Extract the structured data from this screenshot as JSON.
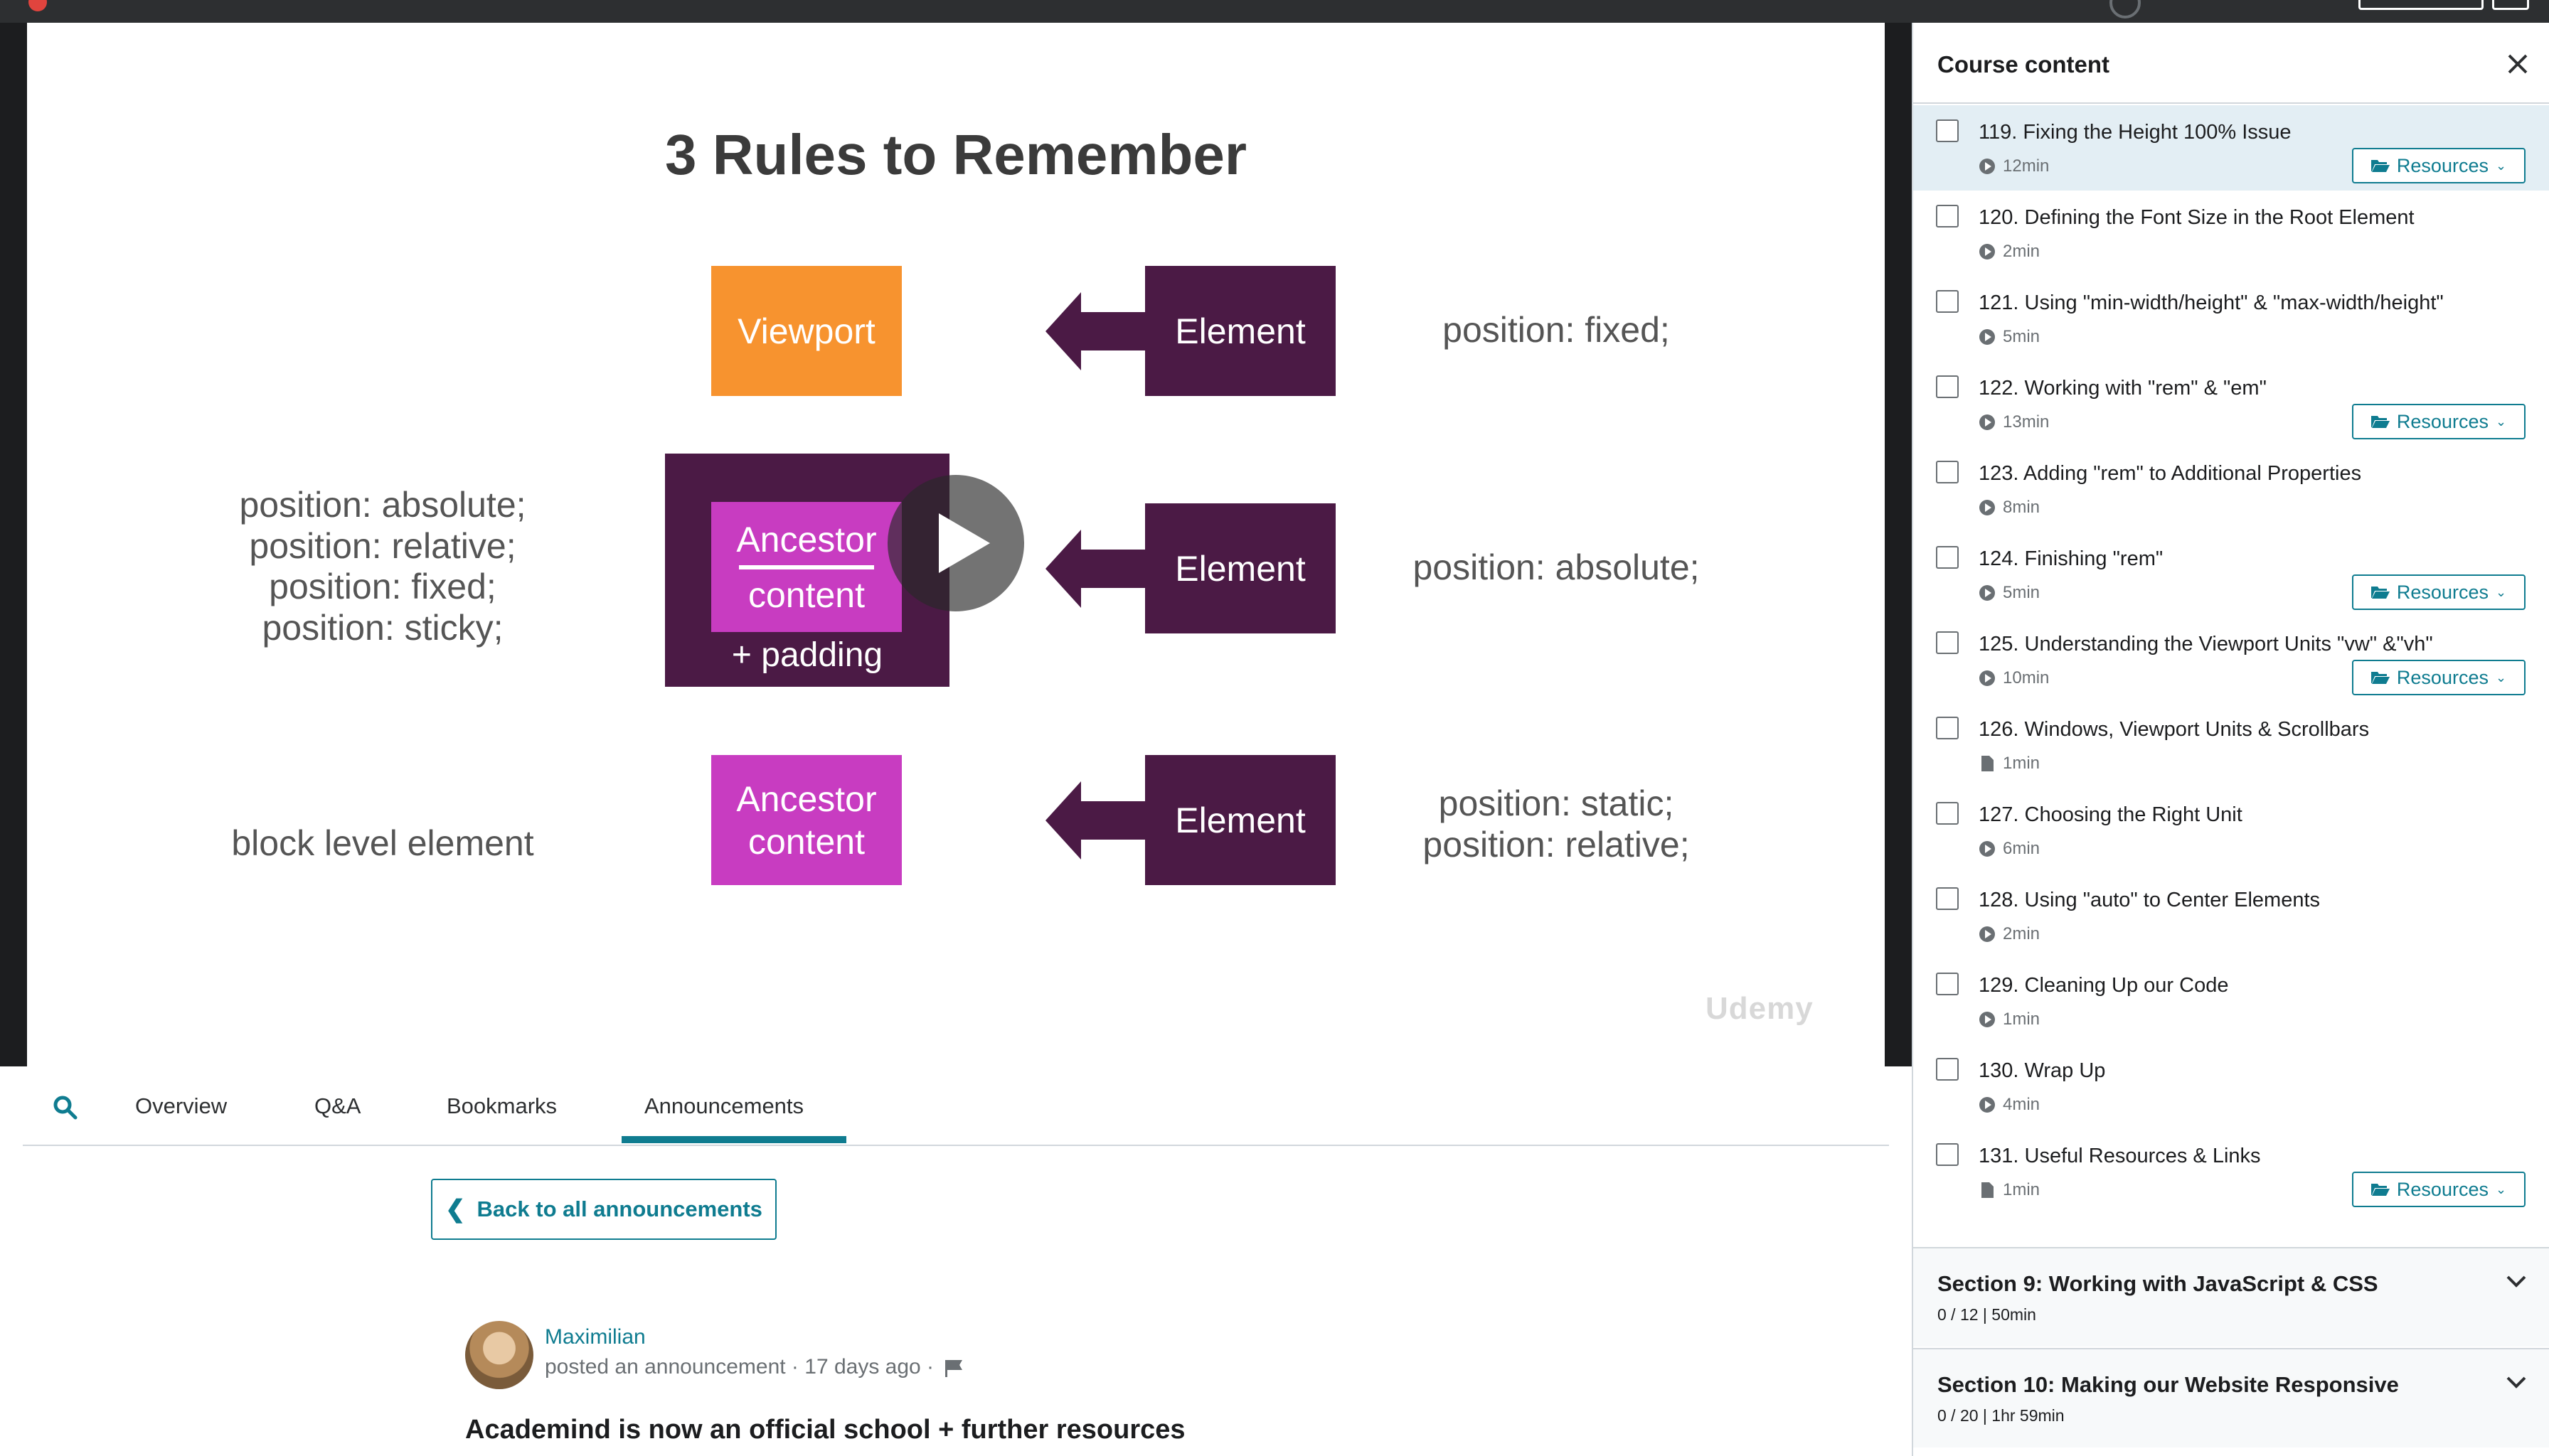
{
  "slide": {
    "title": "3 Rules to Remember",
    "viewport_label": "Viewport",
    "element_label": "Element",
    "ancestor_label": "Ancestor",
    "content_label": "content",
    "padding_label": "+ padding",
    "row1_right": "position: fixed;",
    "row2_left": [
      "position: absolute;",
      "position: relative;",
      "position: fixed;",
      "position: sticky;"
    ],
    "row2_right": "position: absolute;",
    "row3_left": "block level element",
    "row3_right": [
      "position: static;",
      "position: relative;"
    ],
    "watermark": "Udemy"
  },
  "tabs": {
    "overview": "Overview",
    "qa": "Q&A",
    "bookmarks": "Bookmarks",
    "announcements": "Announcements",
    "active": "Announcements"
  },
  "announcement": {
    "back_label": "Back to all announcements",
    "author": "Maximilian",
    "meta": "posted an announcement · 17 days ago ·",
    "title": "Academind is now an official school + further resources"
  },
  "sidebar": {
    "title": "Course content",
    "resources_label": "Resources",
    "lectures": [
      {
        "title": "119. Fixing the Height 100% Issue",
        "duration": "12min",
        "type": "video",
        "resources": true,
        "active": true
      },
      {
        "title": "120. Defining the Font Size in the Root Element",
        "duration": "2min",
        "type": "video",
        "resources": false
      },
      {
        "title": "121. Using \"min-width/height\" & \"max-width/height\"",
        "duration": "5min",
        "type": "video",
        "resources": false
      },
      {
        "title": "122. Working with \"rem\" & \"em\"",
        "duration": "13min",
        "type": "video",
        "resources": true
      },
      {
        "title": "123. Adding \"rem\" to Additional Properties",
        "duration": "8min",
        "type": "video",
        "resources": false
      },
      {
        "title": "124. Finishing \"rem\"",
        "duration": "5min",
        "type": "video",
        "resources": true
      },
      {
        "title": "125. Understanding the Viewport Units \"vw\" &\"vh\"",
        "duration": "10min",
        "type": "video",
        "resources": true
      },
      {
        "title": "126. Windows, Viewport Units & Scrollbars",
        "duration": "1min",
        "type": "article",
        "resources": false
      },
      {
        "title": "127. Choosing the Right Unit",
        "duration": "6min",
        "type": "video",
        "resources": false
      },
      {
        "title": "128. Using \"auto\" to Center Elements",
        "duration": "2min",
        "type": "video",
        "resources": false
      },
      {
        "title": "129. Cleaning Up our Code",
        "duration": "1min",
        "type": "video",
        "resources": false
      },
      {
        "title": "130. Wrap Up",
        "duration": "4min",
        "type": "video",
        "resources": false
      },
      {
        "title": "131. Useful Resources & Links",
        "duration": "1min",
        "type": "article",
        "resources": true
      }
    ],
    "sections": [
      {
        "title": "Section 9: Working with JavaScript & CSS",
        "meta": "0 / 12 | 50min"
      },
      {
        "title": "Section 10: Making our Website Responsive",
        "meta": "0 / 20 | 1hr 59min"
      }
    ]
  },
  "colors": {
    "accent": "#0f7c90",
    "viewport": "#f7932f",
    "element": "#4b1a45",
    "ancestor": "#c83cc1"
  }
}
